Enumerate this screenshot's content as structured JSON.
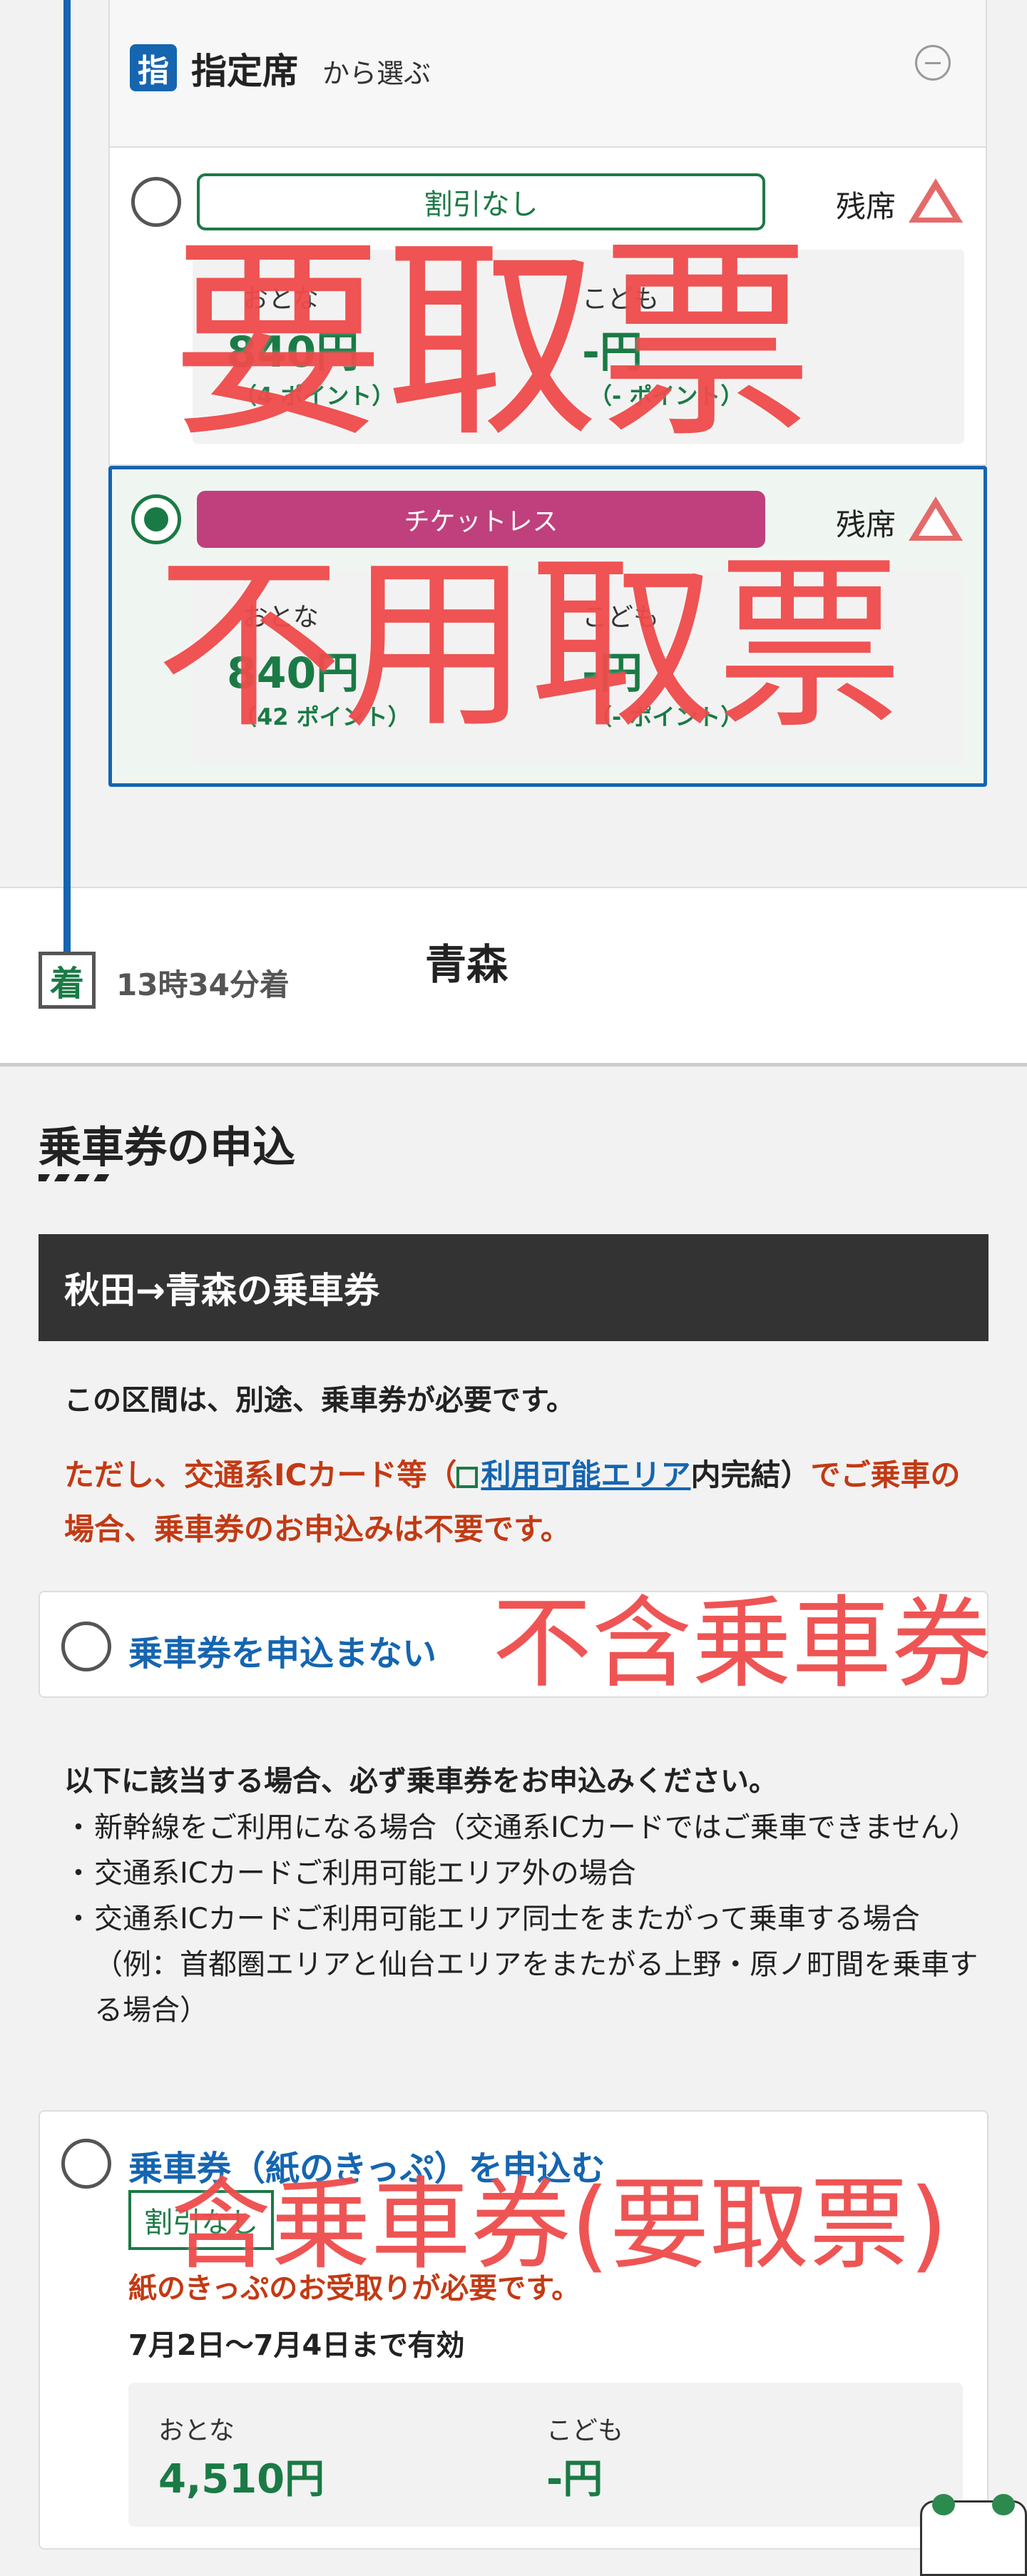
{
  "seat_panel": {
    "icon_char": "指",
    "title": "指定席",
    "title_suffix": "から選ぶ",
    "options": [
      {
        "tag": "割引なし",
        "seat_label": "残席",
        "seat_status": "triangle-warning",
        "adult_label": "おとな",
        "adult_price": "840円",
        "adult_points": "（4 ポイント）",
        "child_label": "こども",
        "child_price": "-円",
        "child_points": "（- ポイント）",
        "selected": false,
        "overlay": "要取票"
      },
      {
        "tag": "チケットレス",
        "seat_label": "残席",
        "seat_status": "triangle-warning",
        "adult_label": "おとな",
        "adult_price": "840円",
        "adult_points": "（42 ポイント）",
        "child_label": "こども",
        "child_price": "-円",
        "child_points": "（- ポイント）",
        "selected": true,
        "overlay": "不用取票"
      }
    ]
  },
  "arrival": {
    "icon_char": "着",
    "time": "13時34分着",
    "station": "青森"
  },
  "ticket_section": {
    "title": "乗車券の申込",
    "route_header": "秋田→青森の乗車券",
    "need_text": "この区間は、別途、乗車券が必要です。",
    "ic_note_prefix": "ただし、交通系ICカード等（",
    "ic_note_link": "利用可能エリア",
    "ic_note_mid": "内完結）",
    "ic_note_suffix": "でご乗車の場合、乗車券のお申込みは不要です。",
    "nonapply_label": "乗車券を申込まない",
    "nonapply_overlay": "不含乗車券",
    "conditions_title": "以下に該当する場合、必ず乗車券をお申込みください。",
    "conditions": [
      "新幹線をご利用になる場合（交通系ICカードではご乗車できません）",
      "交通系ICカードご利用可能エリア外の場合",
      "交通系ICカードご利用可能エリア同士をまたがって乗車する場合（例：首都圏エリアと仙台エリアをまたがる上野・原ノ町間を乗車する場合）"
    ],
    "apply_label": "乗車券（紙のきっぷ）を申込む",
    "apply_tag": "割引なし",
    "apply_overlay": "含乗車券(要取票)",
    "paper_note": "紙のきっぷのお受取りが必要です。",
    "valid_text": "7月2日〜7月4日まで有効",
    "adult_label": "おとな",
    "adult_price": "4,510円",
    "child_label": "こども",
    "child_price": "-円"
  },
  "colors": {
    "brand_blue": "#1565b0",
    "brand_green": "#1a7a45",
    "warning_red": "#c23a14",
    "overlay_red": "#ef4b4b",
    "ticketless_pink": "#c0407d"
  }
}
